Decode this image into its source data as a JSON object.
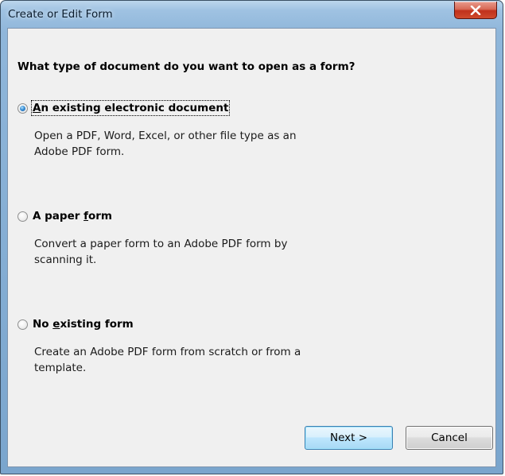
{
  "window": {
    "title": "Create or Edit Form",
    "close_icon": "close-icon (white X)"
  },
  "question": "What type of document do you want to open as a form?",
  "options": [
    {
      "label_pre": "",
      "label_accel": "A",
      "label_post": "n existing electronic document",
      "description_lines": [
        "Open a PDF, Word, Excel, or other file type as an",
        "Adobe PDF form."
      ],
      "selected": true
    },
    {
      "label_pre": "A paper ",
      "label_accel": "f",
      "label_post": "orm",
      "description_lines": [
        "Convert a paper form to an Adobe PDF form by",
        "scanning it."
      ],
      "selected": false
    },
    {
      "label_pre": "No ",
      "label_accel": "e",
      "label_post": "xisting form",
      "description_lines": [
        "Create an Adobe PDF form from scratch or from a",
        "template."
      ],
      "selected": false
    }
  ],
  "buttons": {
    "next": "Next >",
    "cancel": "Cancel"
  },
  "colors": {
    "radio_selected": "#3a8fd4",
    "close_button": "#c0311c",
    "default_button_border": "#3c7fb1"
  }
}
